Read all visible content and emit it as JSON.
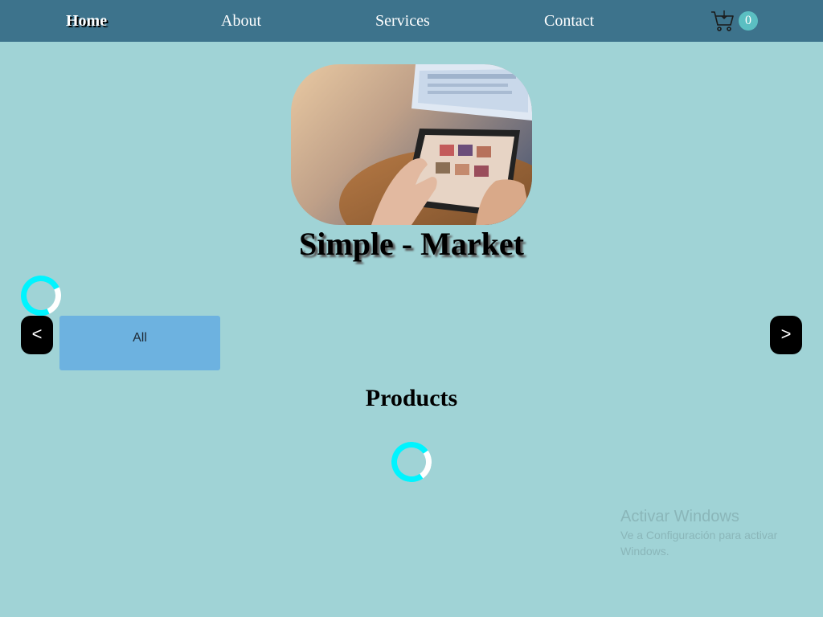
{
  "nav": {
    "items": [
      {
        "label": "Home",
        "active": true
      },
      {
        "label": "About",
        "active": false
      },
      {
        "label": "Services",
        "active": false
      },
      {
        "label": "Contact",
        "active": false
      }
    ],
    "cart_icon": "shopping-cart-icon",
    "cart_count": "0"
  },
  "hero": {
    "image": "person-using-tablet-photo",
    "title": "Simple - Market"
  },
  "categories": {
    "prev_label": "<",
    "next_label": ">",
    "items": [
      {
        "label": "All"
      }
    ]
  },
  "products": {
    "heading": "Products"
  },
  "watermark": {
    "title": "Activar Windows",
    "subtitle": "Ve a Configuración para activar Windows."
  },
  "colors": {
    "background": "#a0d3d6",
    "navbar": "#3d738c",
    "badge": "#5bbfc2",
    "category": "#6db2e0",
    "spinner": "#00f4ff"
  }
}
